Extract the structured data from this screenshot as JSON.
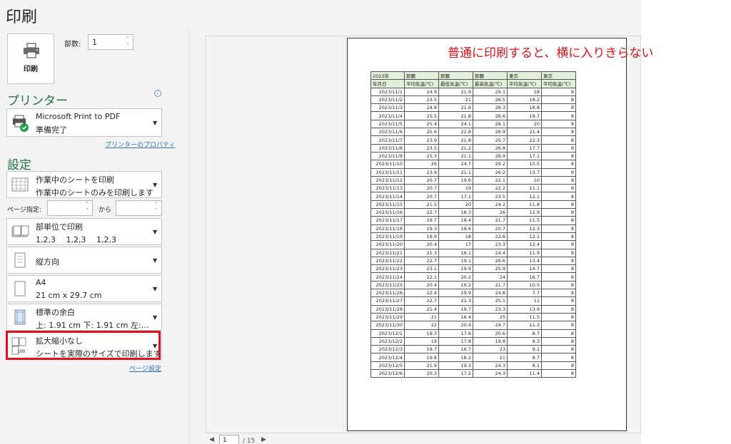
{
  "title": "印刷",
  "print_button": {
    "label": "印刷",
    "icon": "printer-icon"
  },
  "copies": {
    "label": "部数:",
    "value": "1"
  },
  "printer": {
    "section_title": "プリンター",
    "name": "Microsoft Print to PDF",
    "status": "準備完了",
    "properties_link": "プリンターのプロパティ",
    "info_icon": "info-icon"
  },
  "settings": {
    "section_title": "設定",
    "print_what": {
      "line1": "作業中のシートを印刷",
      "line2": "作業中のシートのみを印刷します"
    },
    "pages": {
      "label": "ページ指定:",
      "from_value": "",
      "to_label": "から",
      "to_value": ""
    },
    "collate": {
      "line1": "部単位で印刷",
      "line2": "1,2,3 　1,2,3 　1,2,3"
    },
    "orientation": {
      "line1": "縦方向"
    },
    "paper": {
      "line1": "A4",
      "line2": "21 cm x 29.7 cm"
    },
    "margins": {
      "line1": "標準の余白",
      "line2": "上: 1.91 cm 下: 1.91 cm 左:…"
    },
    "scaling": {
      "line1": "拡大縮小なし",
      "line2": "シートを実際のサイズで印刷します",
      "badge": "100"
    },
    "page_setup_link": "ページ設定"
  },
  "annotation": "普通に印刷すると、横に入りきらない",
  "navigation": {
    "prev": "◀",
    "page": "1",
    "of": "/ 15",
    "next": "▶"
  },
  "table": {
    "header1": [
      "2023年",
      "那覇",
      "那覇",
      "那覇",
      "東京",
      "東京"
    ],
    "header2": [
      "年月日",
      "平均気温(℃)",
      "最低気温(℃)",
      "最高気温(℃)",
      "平均気温(℃)",
      "平均気温(℃)"
    ],
    "rows": [
      [
        "2023/11/1",
        "24.9",
        "21.9",
        "29.1",
        "18",
        "8"
      ],
      [
        "2023/11/2",
        "23.5",
        "21",
        "26.5",
        "18.2",
        "8"
      ],
      [
        "2023/11/3",
        "24.8",
        "21.6",
        "28.3",
        "18.8",
        "8"
      ],
      [
        "2023/11/4",
        "25.5",
        "21.8",
        "28.6",
        "19.7",
        "8"
      ],
      [
        "2023/11/5",
        "25.4",
        "24.1",
        "28.1",
        "20",
        "8"
      ],
      [
        "2023/11/6",
        "25.6",
        "22.8",
        "28.9",
        "21.4",
        "8"
      ],
      [
        "2023/11/7",
        "23.9",
        "21.8",
        "25.7",
        "22.3",
        "8"
      ],
      [
        "2023/11/8",
        "23.5",
        "21.2",
        "26.8",
        "17.7",
        "8"
      ],
      [
        "2023/11/9",
        "25.3",
        "21.1",
        "28.9",
        "17.1",
        "8"
      ],
      [
        "2023/11/10",
        "26",
        "24.7",
        "29.2",
        "15.5",
        "8"
      ],
      [
        "2023/11/11",
        "23.9",
        "21.1",
        "26.2",
        "13.7",
        "8"
      ],
      [
        "2023/11/12",
        "20.7",
        "19.6",
        "22.1",
        "10",
        "8"
      ],
      [
        "2023/11/13",
        "20.7",
        "19",
        "22.2",
        "11.1",
        "8"
      ],
      [
        "2023/11/14",
        "20.7",
        "17.1",
        "23.5",
        "12.1",
        "8"
      ],
      [
        "2023/11/15",
        "21.5",
        "20",
        "24.2",
        "11.8",
        "8"
      ],
      [
        "2023/11/16",
        "22.7",
        "18.3",
        "26",
        "12.9",
        "8"
      ],
      [
        "2023/11/17",
        "19.7",
        "18.4",
        "21.7",
        "11.5",
        "8"
      ],
      [
        "2023/11/18",
        "19.3",
        "18.6",
        "20.7",
        "12.3",
        "8"
      ],
      [
        "2023/11/19",
        "19.9",
        "18",
        "22.6",
        "12.1",
        "8"
      ],
      [
        "2023/11/20",
        "20.4",
        "17",
        "23.3",
        "12.4",
        "8"
      ],
      [
        "2023/11/21",
        "21.3",
        "18.1",
        "24.4",
        "11.9",
        "8"
      ],
      [
        "2023/11/22",
        "22.7",
        "19.1",
        "26.6",
        "13.4",
        "8"
      ],
      [
        "2023/11/23",
        "23.1",
        "19.9",
        "25.9",
        "14.7",
        "8"
      ],
      [
        "2023/11/24",
        "22.1",
        "20.2",
        "24",
        "16.7",
        "8"
      ],
      [
        "2023/11/25",
        "20.4",
        "19.2",
        "21.7",
        "10.5",
        "8"
      ],
      [
        "2023/11/26",
        "22.4",
        "19.9",
        "24.8",
        "7.7",
        "8"
      ],
      [
        "2023/11/27",
        "22.7",
        "21.3",
        "25.1",
        "11",
        "8"
      ],
      [
        "2023/11/28",
        "21.4",
        "19.7",
        "23.3",
        "13.9",
        "8"
      ],
      [
        "2023/11/29",
        "21",
        "16.4",
        "25",
        "11.5",
        "8"
      ],
      [
        "2023/11/30",
        "22",
        "20.4",
        "24.7",
        "11.3",
        "8"
      ],
      [
        "2023/12/1",
        "19.3",
        "17.6",
        "20.6",
        "8.7",
        "8"
      ],
      [
        "2023/12/2",
        "19",
        "17.8",
        "19.8",
        "8.3",
        "8"
      ],
      [
        "2023/12/3",
        "19.7",
        "16.7",
        "23",
        "9.1",
        "8"
      ],
      [
        "2023/12/4",
        "19.8",
        "18.2",
        "21",
        "8.7",
        "8"
      ],
      [
        "2023/12/5",
        "21.9",
        "19.3",
        "24.3",
        "8.1",
        "8"
      ],
      [
        "2023/12/6",
        "20.3",
        "17.2",
        "24.3",
        "11.4",
        "8"
      ]
    ]
  }
}
